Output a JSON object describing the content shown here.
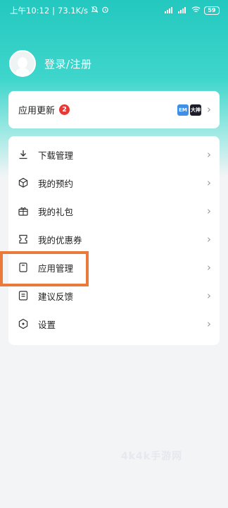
{
  "statusbar": {
    "time": "上午10:12",
    "speed": "73.1K/s",
    "battery": "59"
  },
  "profile": {
    "login_label": "登录/注册"
  },
  "update": {
    "label": "应用更新",
    "badge": "2",
    "thumb_a": "EM",
    "thumb_b": "大神"
  },
  "menu": {
    "items": [
      {
        "label": "下载管理",
        "icon": "download-icon"
      },
      {
        "label": "我的预约",
        "icon": "box-icon"
      },
      {
        "label": "我的礼包",
        "icon": "gift-icon"
      },
      {
        "label": "我的优惠券",
        "icon": "coupon-icon"
      },
      {
        "label": "应用管理",
        "icon": "app-manage-icon"
      },
      {
        "label": "建议反馈",
        "icon": "feedback-icon"
      },
      {
        "label": "设置",
        "icon": "settings-icon"
      }
    ]
  },
  "watermark": "4k4k手游网",
  "colors": {
    "accent": "#2ac8be",
    "highlight": "#ea7a3a",
    "badge": "#e53935"
  }
}
